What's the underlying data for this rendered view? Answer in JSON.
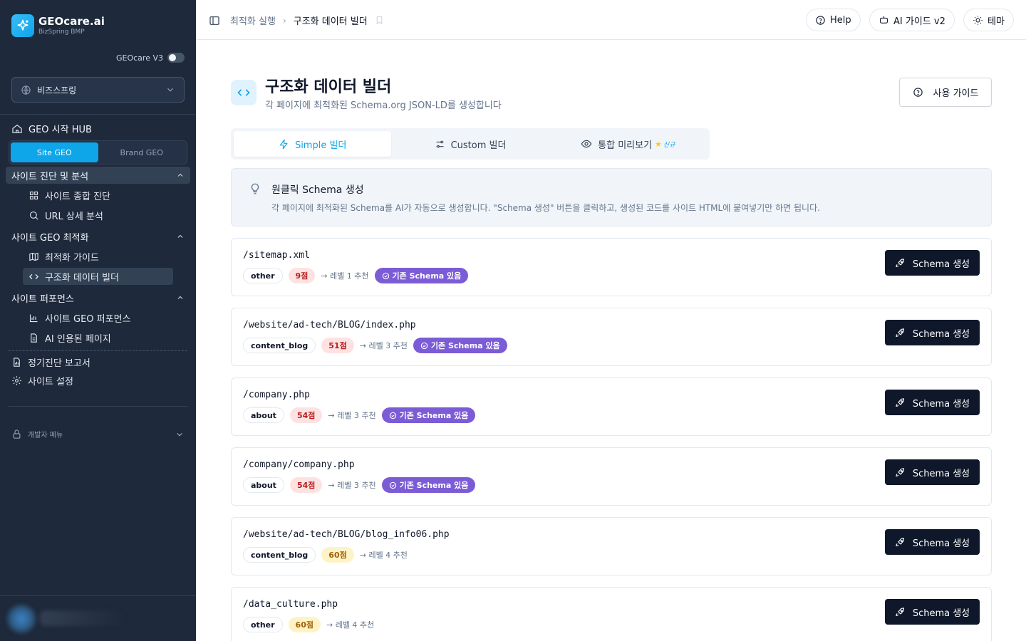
{
  "app": {
    "name": "GEOcare.ai",
    "sub": "BizSpring BMP",
    "version_label": "GEOcare V3"
  },
  "org": {
    "name": "비즈스프링"
  },
  "sidebar": {
    "hub": "GEO 시작 HUB",
    "geo_toggle": {
      "site": "Site GEO",
      "brand": "Brand GEO",
      "active": "site"
    },
    "sections": [
      {
        "title": "사이트 진단 및 분석",
        "items": [
          {
            "label": "사이트 종합 진단",
            "icon": "grid-icon"
          },
          {
            "label": "URL 상세 분석",
            "icon": "search-icon"
          }
        ]
      },
      {
        "title": "사이트 GEO 최적화",
        "items": [
          {
            "label": "최적화 가이드",
            "icon": "map-icon"
          },
          {
            "label": "구조화 데이터 빌더",
            "icon": "code-icon",
            "active": true
          }
        ]
      },
      {
        "title": "사이트 퍼포먼스",
        "items": [
          {
            "label": "사이트 GEO 퍼포먼스",
            "icon": "bar-chart-icon"
          },
          {
            "label": "AI 인용된 페이지",
            "icon": "file-icon"
          }
        ]
      }
    ],
    "report": "정기진단 보고서",
    "settings": "사이트 설정",
    "dev_menu": "개발자 메뉴"
  },
  "header": {
    "breadcrumb": {
      "parent": "최적화 실행",
      "current": "구조화 데이터 빌더"
    },
    "help": "Help",
    "ai_guide": "AI 가이드 v2",
    "theme": "테마"
  },
  "page": {
    "title": "구조화 데이터 빌더",
    "subtitle": "각 페이지에 최적화된 Schema.org JSON-LD를 생성합니다",
    "guide_button": "사용 가이드",
    "tabs": [
      {
        "label": "Simple 빌더",
        "active": true
      },
      {
        "label": "Custom 빌더"
      },
      {
        "label": "통합 미리보기",
        "badge": "신규"
      }
    ],
    "info": {
      "title": "원클릭 Schema 생성",
      "desc": "각 페이지에 최적화된 Schema를 AI가 자동으로 생성합니다. \"Schema 생성\" 버튼을 클릭하고, 생성된 코드를 사이트 HTML에 붙여넣기만 하면 됩니다."
    },
    "generate_label": "Schema 생성",
    "existing_label": "기존 Schema 있음",
    "pages": [
      {
        "path": "/sitemap.xml",
        "type": "other",
        "score": "9점",
        "level": "→ 레벨 1 추천",
        "existing": true,
        "tone": "low"
      },
      {
        "path": "/website/ad-tech/BLOG/index.php",
        "type": "content_blog",
        "score": "51점",
        "level": "→ 레벨 3 추천",
        "existing": true,
        "tone": "low"
      },
      {
        "path": "/company.php",
        "type": "about",
        "score": "54점",
        "level": "→ 레벨 3 추천",
        "existing": true,
        "tone": "low"
      },
      {
        "path": "/company/company.php",
        "type": "about",
        "score": "54점",
        "level": "→ 레벨 3 추천",
        "existing": true,
        "tone": "low"
      },
      {
        "path": "/website/ad-tech/BLOG/blog_info06.php",
        "type": "content_blog",
        "score": "60점",
        "level": "→ 레벨 4 추천",
        "existing": false,
        "tone": "mid"
      },
      {
        "path": "/data_culture.php",
        "type": "other",
        "score": "60점",
        "level": "→ 레벨 4 추천",
        "existing": false,
        "tone": "mid"
      }
    ]
  },
  "colors": {
    "sidebar_bg": "#1e293b",
    "accent": "#0ea5e9",
    "primary_button": "#0f172a",
    "schema_badge": "#7c5cd6",
    "score_low": "#fee2e2",
    "score_mid": "#fef3c7"
  }
}
